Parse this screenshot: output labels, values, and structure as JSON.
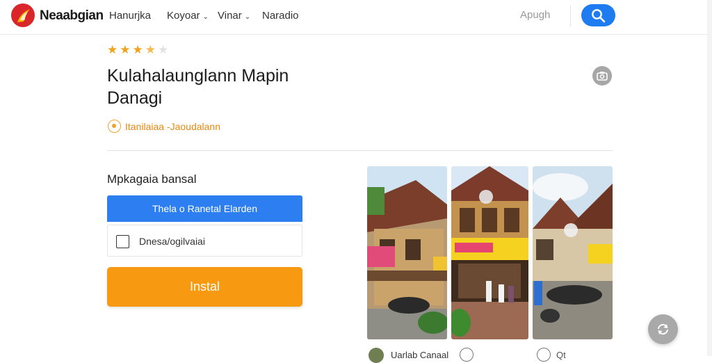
{
  "header": {
    "brand": "Neaabgian",
    "nav": [
      {
        "label": "Hanurjka",
        "has_menu": false
      },
      {
        "label": "Koyoar",
        "has_menu": true
      },
      {
        "label": "Vinar",
        "has_menu": true
      },
      {
        "label": "Naradio",
        "has_menu": false
      }
    ],
    "link": "Apugh",
    "search_icon": "search-icon",
    "chevron_glyph": "⌄"
  },
  "app": {
    "rating": 3.5,
    "rating_max": 5,
    "title": "Kulahalaunglann Mapin Danagi",
    "developer": "Itanilaiaa -Jaoudalann"
  },
  "install_panel": {
    "section_label": "Mpkagaia bansal",
    "primary_button": "Thela o Ranetal Elarden",
    "option_label": "Dnesa/ogilvaiai",
    "option_checked": false,
    "install_button": "Instal"
  },
  "footer_row": {
    "author": "Uarlab Canaal",
    "extra": "Qt"
  },
  "colors": {
    "accent_blue": "#2d7ff1",
    "install_orange": "#f79a12",
    "star": "#f2a21b",
    "brand_red": "#d8262b",
    "developer_text": "#e58a10"
  }
}
